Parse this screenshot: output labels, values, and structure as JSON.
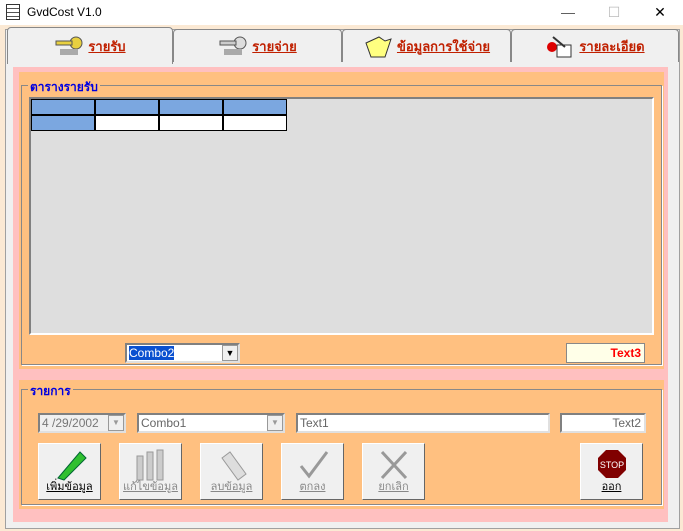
{
  "window": {
    "title": "GvdCost V1.0",
    "minimize": "—",
    "maximize": "☐",
    "close": "✕"
  },
  "tabs": [
    {
      "label": "รายรับ",
      "icon": "key-gold-icon"
    },
    {
      "label": "รายจ่าย",
      "icon": "key-silver-icon"
    },
    {
      "label": "ข้อมูลการใช้จ่าย",
      "icon": "folder-icon"
    },
    {
      "label": "รายละเอียด",
      "icon": "report-icon"
    }
  ],
  "income_group": {
    "legend": "ตารางรายรับ",
    "combo": "Combo2",
    "text": "Text3"
  },
  "items_group": {
    "legend": "รายการ",
    "date": "4 /29/2002",
    "combo": "Combo1",
    "text1": "Text1",
    "text2": "Text2"
  },
  "buttons": {
    "add": "เพิ่มข้อมูล",
    "edit": "แก้ไขข้อมูล",
    "delete": "ลบข้อมูล",
    "ok": "ตกลง",
    "cancel": "ยกเลิก",
    "exit": "ออก",
    "stop": "STOP"
  },
  "colors": {
    "header_cell": "#7ba7e0",
    "legend": "#0000e0",
    "tab_label": "#c02000",
    "text3": "#ff0000"
  }
}
